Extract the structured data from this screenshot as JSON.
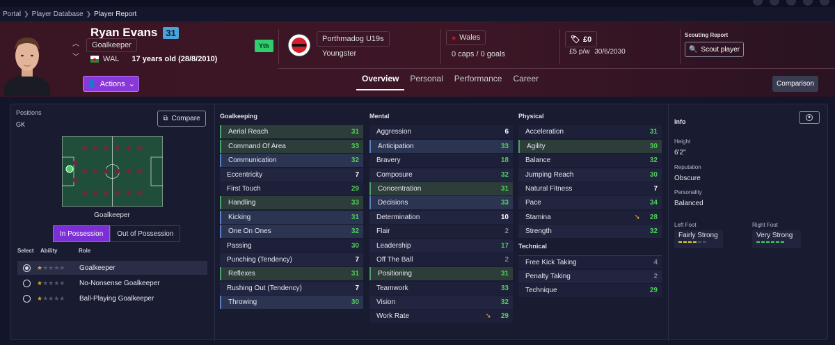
{
  "breadcrumb": [
    "Portal",
    "Player Database",
    "Player Report"
  ],
  "player": {
    "name": "Ryan Evans",
    "ca": "31",
    "position": "Goalkeeper",
    "nation": "WAL",
    "age_text": "17 years old (28/8/2010)",
    "tag": "Yth"
  },
  "actions_label": "Actions",
  "club": {
    "name": "Porthmadog U19s",
    "status": "Youngster"
  },
  "intl": {
    "country": "Wales",
    "caps": "0 caps / 0 goals"
  },
  "value": {
    "amount": "£0",
    "wage": "£5 p/w",
    "expires": "30/6/2030"
  },
  "scouting": {
    "title": "Scouting Report",
    "button": "Scout player"
  },
  "tabs": [
    "Overview",
    "Personal",
    "Performance",
    "Career"
  ],
  "comparison_label": "Comparison",
  "left": {
    "positions_label": "Positions",
    "position_code": "GK",
    "compare_label": "Compare",
    "pitch_caption": "Goalkeeper",
    "possession_tabs": [
      "In Possession",
      "Out of Possession"
    ],
    "role_headers": {
      "select": "Select",
      "ability": "Ability",
      "role": "Role"
    },
    "roles": [
      {
        "name": "Goalkeeper",
        "selected": true
      },
      {
        "name": "No-Nonsense Goalkeeper",
        "selected": false
      },
      {
        "name": "Ball-Playing Goalkeeper",
        "selected": false
      }
    ]
  },
  "goalkeeping": {
    "title": "Goalkeeping",
    "attrs": [
      {
        "name": "Aerial Reach",
        "value": "31"
      },
      {
        "name": "Command Of Area",
        "value": "33"
      },
      {
        "name": "Communication",
        "value": "32"
      },
      {
        "name": "Eccentricity",
        "value": "7"
      },
      {
        "name": "First Touch",
        "value": "29"
      },
      {
        "name": "Handling",
        "value": "33"
      },
      {
        "name": "Kicking",
        "value": "31"
      },
      {
        "name": "One On Ones",
        "value": "32"
      },
      {
        "name": "Passing",
        "value": "30"
      },
      {
        "name": "Punching (Tendency)",
        "value": "7"
      },
      {
        "name": "Reflexes",
        "value": "31"
      },
      {
        "name": "Rushing Out (Tendency)",
        "value": "7"
      },
      {
        "name": "Throwing",
        "value": "30"
      }
    ]
  },
  "mental": {
    "title": "Mental",
    "attrs": [
      {
        "name": "Aggression",
        "value": "6"
      },
      {
        "name": "Anticipation",
        "value": "33"
      },
      {
        "name": "Bravery",
        "value": "18"
      },
      {
        "name": "Composure",
        "value": "32"
      },
      {
        "name": "Concentration",
        "value": "31"
      },
      {
        "name": "Decisions",
        "value": "33"
      },
      {
        "name": "Determination",
        "value": "10"
      },
      {
        "name": "Flair",
        "value": "2"
      },
      {
        "name": "Leadership",
        "value": "17"
      },
      {
        "name": "Off The Ball",
        "value": "2"
      },
      {
        "name": "Positioning",
        "value": "31"
      },
      {
        "name": "Teamwork",
        "value": "33"
      },
      {
        "name": "Vision",
        "value": "32"
      },
      {
        "name": "Work Rate",
        "value": "29"
      }
    ]
  },
  "physical": {
    "title": "Physical",
    "attrs": [
      {
        "name": "Acceleration",
        "value": "31"
      },
      {
        "name": "Agility",
        "value": "30"
      },
      {
        "name": "Balance",
        "value": "32"
      },
      {
        "name": "Jumping Reach",
        "value": "30"
      },
      {
        "name": "Natural Fitness",
        "value": "7"
      },
      {
        "name": "Pace",
        "value": "34"
      },
      {
        "name": "Stamina",
        "value": "28"
      },
      {
        "name": "Strength",
        "value": "32"
      }
    ]
  },
  "technical": {
    "title": "Technical",
    "attrs": [
      {
        "name": "Free Kick Taking",
        "value": "4"
      },
      {
        "name": "Penalty Taking",
        "value": "2"
      },
      {
        "name": "Technique",
        "value": "29"
      }
    ]
  },
  "info": {
    "title": "Info",
    "height_label": "Height",
    "height": "6'2\"",
    "reputation_label": "Reputation",
    "reputation": "Obscure",
    "personality_label": "Personality",
    "personality": "Balanced",
    "left_foot_label": "Left Foot",
    "left_foot": "Fairly Strong",
    "right_foot_label": "Right Foot",
    "right_foot": "Very Strong"
  }
}
